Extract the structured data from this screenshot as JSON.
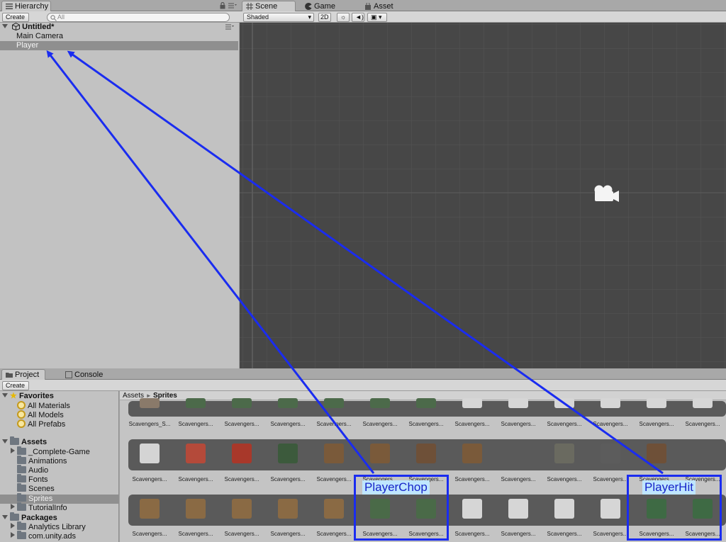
{
  "hierarchy": {
    "tab_label": "Hierarchy",
    "create_label": "Create",
    "search_placeholder": "All",
    "scene_name": "Untitled*",
    "items": [
      "Main Camera",
      "Player"
    ]
  },
  "scene_view": {
    "tabs": [
      "Scene",
      "Game",
      "Asset Store"
    ],
    "shading_mode": "Shaded",
    "toggle_2d": "2D"
  },
  "project": {
    "tabs": [
      "Project",
      "Console"
    ],
    "create_label": "Create",
    "breadcrumb": [
      "Assets",
      "Sprites"
    ],
    "favorites_label": "Favorites",
    "favorites": [
      "All Materials",
      "All Models",
      "All Prefabs"
    ],
    "assets_label": "Assets",
    "folders": [
      "_Complete-Game",
      "Animations",
      "Audio",
      "Fonts",
      "Scenes",
      "Sprites",
      "TutorialInfo"
    ],
    "packages_label": "Packages",
    "packages": [
      "Analytics Library",
      "com.unity.ads"
    ],
    "row1_labels": [
      "Scavengers_S...",
      "Scavengers...",
      "Scavengers...",
      "Scavengers...",
      "Scavengers...",
      "Scavengers...",
      "Scavengers...",
      "Scavengers...",
      "Scavengers...",
      "Scavengers...",
      "Scavengers...",
      "Scavengers...",
      "Scavengers..."
    ],
    "row2_labels": [
      "Scavengers...",
      "Scavengers...",
      "Scavengers...",
      "Scavengers...",
      "Scavengers...",
      "Scavengers...",
      "Scavengers...",
      "Scavengers...",
      "Scavengers...",
      "Scavengers...",
      "Scavengers...",
      "Scavengers...",
      "Scavengers..."
    ],
    "row3_labels": [
      "Scavengers...",
      "Scavengers...",
      "Scavengers...",
      "Scavengers...",
      "Scavengers...",
      "Scavengers...",
      "Scavengers...",
      "Scavengers...",
      "Scavengers...",
      "Scavengers...",
      "Scavengers...",
      "Scavengers...",
      "Scavengers..."
    ]
  },
  "annotations": {
    "left_label": "PlayerChop",
    "right_label": "PlayerHit",
    "arrow_color": "#1a2cf0"
  }
}
